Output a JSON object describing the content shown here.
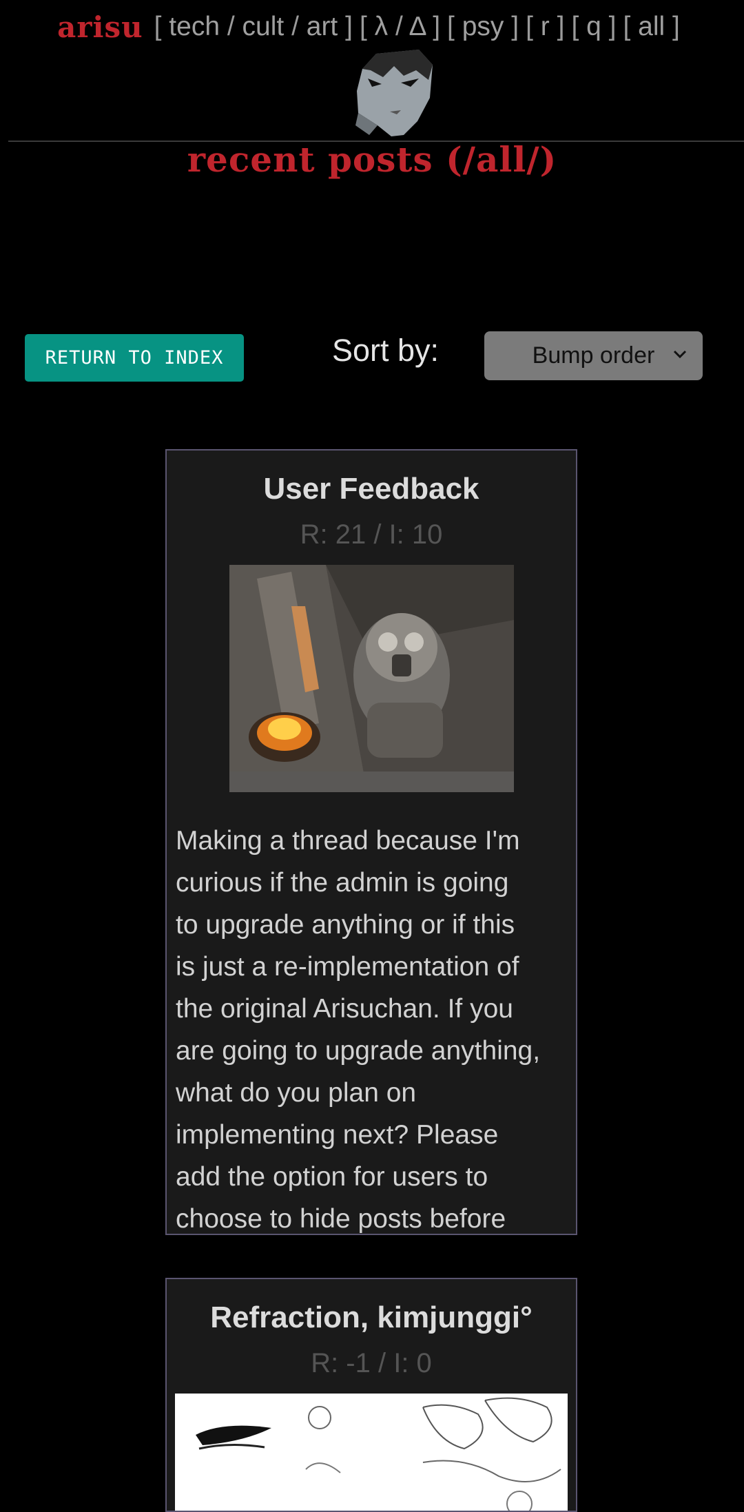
{
  "nav": {
    "brand": "arisu",
    "groups": [
      [
        "tech",
        "cult",
        "art"
      ],
      [
        "λ",
        "Δ"
      ],
      [
        "psy"
      ],
      [
        "r"
      ],
      [
        "q"
      ],
      [
        "all"
      ]
    ]
  },
  "page_title": "recent posts (/all/)",
  "controls": {
    "return_label": "RETURN TO INDEX",
    "sort_label": "Sort by:",
    "sort_value": "Bump order"
  },
  "threads": [
    {
      "title": "User Feedback",
      "stats": "R: 21 / I: 10",
      "body_lines": [
        "Making a thread because I'm",
        "curious if the admin is going",
        "to upgrade anything or if this",
        "is just a re-implementation of",
        "the original Arisuchan. If you",
        "are going to upgrade anything,",
        "what do you plan on",
        "implementing next? Please",
        "add the option for users to",
        "choose to hide posts before"
      ]
    },
    {
      "title": "Refraction, kimjunggi°",
      "stats": "R: -1 / I: 0"
    }
  ],
  "colors": {
    "brand_red": "#c0252d",
    "button_teal": "#079383",
    "card_border": "#5a5570"
  }
}
